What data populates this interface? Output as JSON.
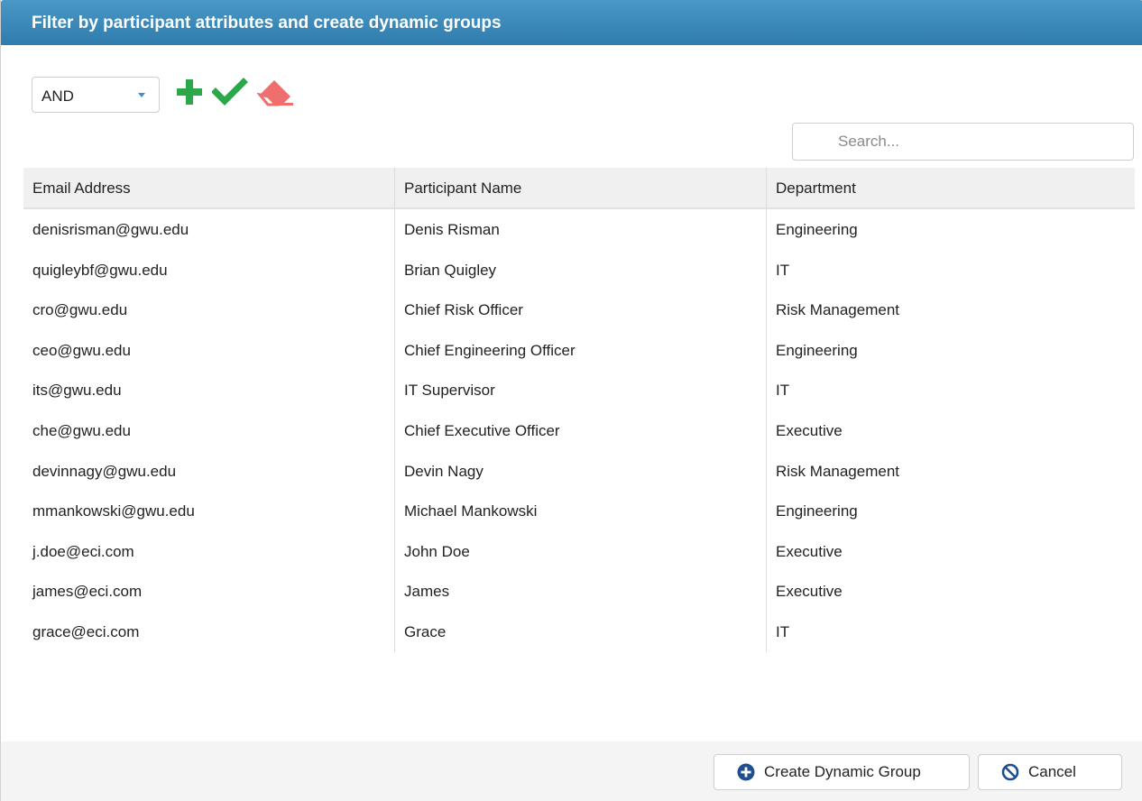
{
  "dialog": {
    "title": "Filter by participant attributes and create dynamic groups"
  },
  "toolbar": {
    "operator": {
      "selected": "AND"
    },
    "icons": {
      "add": "plus-icon",
      "apply": "checkmark-icon",
      "clear": "eraser-icon"
    },
    "colors": {
      "add": "#2aa84a",
      "apply": "#2aa84a",
      "clear": "#ef6f6f"
    }
  },
  "search": {
    "placeholder": "Search...",
    "value": ""
  },
  "grid": {
    "columns": [
      "Email Address",
      "Participant Name",
      "Department"
    ],
    "rows": [
      [
        "denisrisman@gwu.edu",
        "Denis Risman",
        "Engineering"
      ],
      [
        "quigleybf@gwu.edu",
        "Brian Quigley",
        "IT"
      ],
      [
        "cro@gwu.edu",
        "Chief Risk Officer",
        "Risk Management"
      ],
      [
        "ceo@gwu.edu",
        "Chief Engineering Officer",
        "Engineering"
      ],
      [
        "its@gwu.edu",
        "IT Supervisor",
        "IT"
      ],
      [
        "che@gwu.edu",
        "Chief Executive Officer",
        "Executive"
      ],
      [
        "devinnagy@gwu.edu",
        "Devin Nagy",
        "Risk Management"
      ],
      [
        "mmankowski@gwu.edu",
        "Michael Mankowski",
        "Engineering"
      ],
      [
        "j.doe@eci.com",
        "John Doe",
        "Executive"
      ],
      [
        "james@eci.com",
        "James",
        "Executive"
      ],
      [
        "grace@eci.com",
        "Grace",
        "IT"
      ]
    ]
  },
  "footer": {
    "create_label": "Create Dynamic Group",
    "cancel_label": "Cancel"
  },
  "colors": {
    "title_bar": "#3a8bbd",
    "button_icon": "#1f4f8f"
  }
}
